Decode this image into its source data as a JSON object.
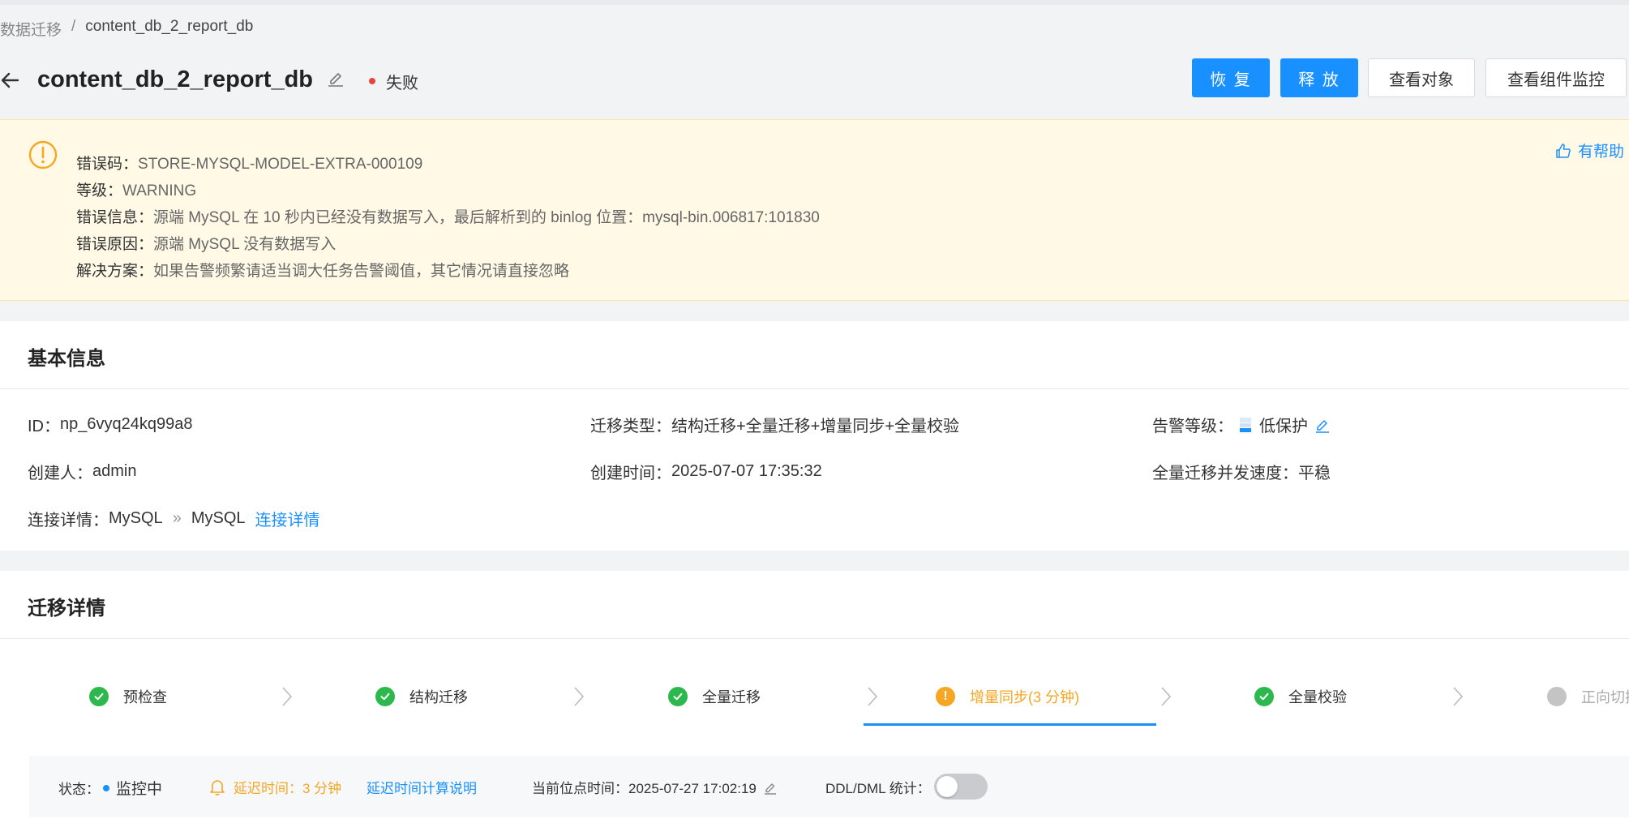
{
  "breadcrumb": {
    "parent": "数据迁移",
    "separator": "/",
    "current": "content_db_2_report_db"
  },
  "header": {
    "title": "content_db_2_report_db",
    "status": "失败",
    "status_color": "#e8453c",
    "buttons": {
      "restore": "恢 复",
      "release": "释 放",
      "view_objects": "查看对象",
      "view_monitor": "查看组件监控"
    }
  },
  "alert": {
    "helpful": "有帮助",
    "code_label": "错误码：",
    "code": "STORE-MYSQL-MODEL-EXTRA-000109",
    "level_label": "等级：",
    "level": "WARNING",
    "message_label": "错误信息：",
    "message": "源端 MySQL 在 10 秒内已经没有数据写入，最后解析到的 binlog 位置：mysql-bin.006817:101830",
    "reason_label": "错误原因：",
    "reason": "源端 MySQL 没有数据写入",
    "solution_label": "解决方案：",
    "solution": "如果告警频繁请适当调大任务告警阈值，其它情况请直接忽略"
  },
  "basic": {
    "title": "基本信息",
    "id_label": "ID：",
    "id": "np_6vyq24kq99a8",
    "type_label": "迁移类型：",
    "type": "结构迁移+全量迁移+增量同步+全量校验",
    "alarm_label": "告警等级：",
    "alarm": "低保护",
    "creator_label": "创建人：",
    "creator": "admin",
    "created_label": "创建时间：",
    "created": "2025-07-07 17:35:32",
    "speed_label": "全量迁移并发速度：",
    "speed": "平稳",
    "conn_label": "连接详情：",
    "conn_src": "MySQL",
    "conn_sep": "»",
    "conn_dst": "MySQL",
    "conn_link": "连接详情"
  },
  "migrate": {
    "title": "迁移详情",
    "steps": [
      {
        "label": "预检查",
        "state": "done"
      },
      {
        "label": "结构迁移",
        "state": "done"
      },
      {
        "label": "全量迁移",
        "state": "done"
      },
      {
        "label": "增量同步(3 分钟)",
        "state": "warning"
      },
      {
        "label": "全量校验",
        "state": "done"
      },
      {
        "label": "正向切换",
        "state": "pending"
      }
    ],
    "status_label": "状态：",
    "status": "监控中",
    "delay": "延迟时间：3 分钟",
    "delay_link": "延迟时间计算说明",
    "position_time": "当前位点时间：2025-07-27 17:02:19",
    "ddl_label": "DDL/DML 统计：",
    "ddl_enabled": false
  },
  "colors": {
    "primary": "#1890ff",
    "success": "#2db84d",
    "warning": "#f5a623",
    "danger": "#e8453c"
  }
}
